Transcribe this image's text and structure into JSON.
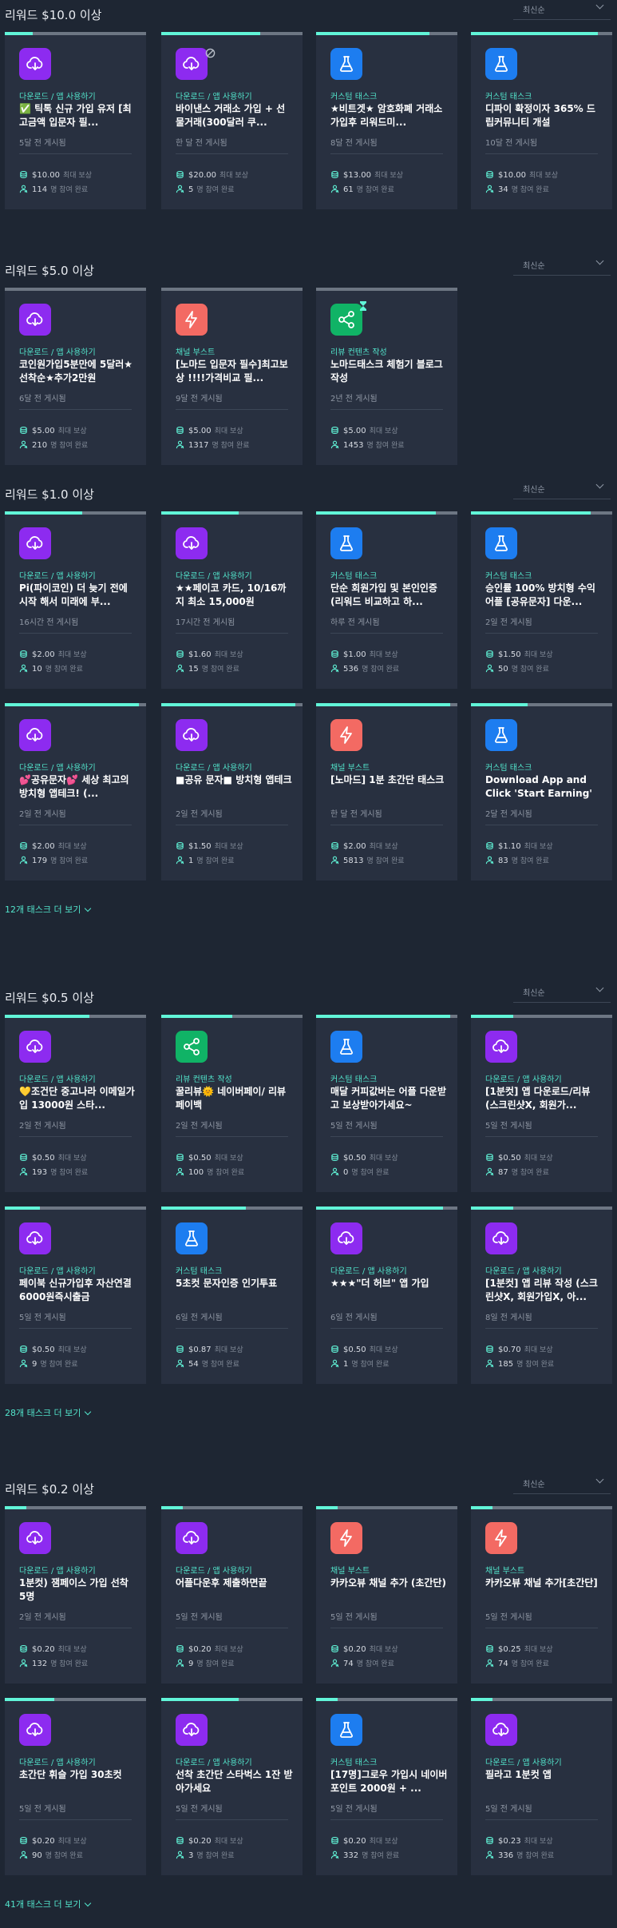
{
  "sort_label": "최신순",
  "labels": {
    "max_reward": "최대 보상",
    "participants": "명 참여 완료"
  },
  "sections": [
    {
      "title": "리워드 $10.0 이상",
      "tasks": [
        {
          "icon": "download-cloud-icon",
          "color": "purple",
          "progress": 0.2,
          "category": "다운로드 / 앱 사용하기",
          "title": "✅ 틱톡 신규 가입 유저 [최고금액 입문자 필...",
          "posted": "5달 전 게시됨",
          "reward": "$10.00",
          "people": "114"
        },
        {
          "icon": "download-cloud-icon",
          "color": "purple",
          "progress": 0.7,
          "blocked": true,
          "category": "다운로드 / 앱 사용하기",
          "title": "바이낸스 거래소 가입 + 선물거래(300달러 쿠...",
          "posted": "한 달 전 게시됨",
          "reward": "$20.00",
          "people": "5"
        },
        {
          "icon": "flask-icon",
          "color": "blue",
          "progress": 0.8,
          "category": "커스텀 태스크",
          "title": "★비트겟★ 암호화폐 거래소 가입후 리워드미...",
          "posted": "8달 전 게시됨",
          "reward": "$13.00",
          "people": "61"
        },
        {
          "icon": "flask-icon",
          "color": "blue",
          "progress": 0.9,
          "category": "커스텀 태스크",
          "title": "디파이 확정이자 365% 드립커뮤니티 개설",
          "posted": "10달 전 게시됨",
          "reward": "$10.00",
          "people": "34"
        }
      ]
    },
    {
      "title": "리워드 $5.0 이상",
      "tasks": [
        {
          "icon": "download-cloud-icon",
          "color": "purple",
          "progress": 0.0,
          "category": "다운로드 / 앱 사용하기",
          "title": "코인원가입5분만에 5달러★선착순★추가2만원",
          "posted": "6달 전 게시됨",
          "reward": "$5.00",
          "people": "210"
        },
        {
          "icon": "lightning-icon",
          "color": "red",
          "progress": 0.0,
          "category": "채널 부스트",
          "title": "[노마드 입문자 필수]최고보상 !!!!가격비교 필...",
          "posted": "9달 전 게시됨",
          "reward": "$5.00",
          "people": "1317"
        },
        {
          "icon": "share-icon",
          "color": "green",
          "progress": 0.0,
          "pinned": true,
          "category": "리뷰 컨텐츠 작성",
          "title": "노마드태스크 체험기 블로그 작성",
          "posted": "2년 전 게시됨",
          "reward": "$5.00",
          "people": "1453"
        }
      ]
    },
    {
      "title": "리워드 $1.0 이상",
      "tasks": [
        {
          "icon": "download-cloud-icon",
          "color": "purple",
          "progress": 0.55,
          "category": "다운로드 / 앱 사용하기",
          "title": "Pi(파이코인) 더 늦기 전에 시작 해서 미래에 부...",
          "posted": "16시간 전 게시됨",
          "reward": "$2.00",
          "people": "10"
        },
        {
          "icon": "download-cloud-icon",
          "color": "purple",
          "progress": 0.55,
          "category": "다운로드 / 앱 사용하기",
          "title": "★★페이코 카드, 10/16까지 최소 15,000원",
          "posted": "17시간 전 게시됨",
          "reward": "$1.60",
          "people": "15"
        },
        {
          "icon": "flask-icon",
          "color": "blue",
          "progress": 0.85,
          "category": "커스텀 태스크",
          "title": "단순 회원가입 및 본인인증(리워드 비교하고 하...",
          "posted": "하루 전 게시됨",
          "reward": "$1.00",
          "people": "536"
        },
        {
          "icon": "flask-icon",
          "color": "blue",
          "progress": 0.85,
          "category": "커스텀 태스크",
          "title": "승인률 100% 방치형 수익어플 [공유문자] 다운...",
          "posted": "2일 전 게시됨",
          "reward": "$1.50",
          "people": "50"
        },
        {
          "icon": "download-cloud-icon",
          "color": "purple",
          "progress": 0.95,
          "category": "다운로드 / 앱 사용하기",
          "title": "💕공유문자💕 세상 최고의 방치형 앱테크! (...",
          "posted": "2일 전 게시됨",
          "reward": "$2.00",
          "people": "179"
        },
        {
          "icon": "download-cloud-icon",
          "color": "purple",
          "progress": 0.95,
          "category": "다운로드 / 앱 사용하기",
          "title": "■공유 문자■ 방치형 앱테크",
          "posted": "2일 전 게시됨",
          "reward": "$1.50",
          "people": "1"
        },
        {
          "icon": "lightning-icon",
          "color": "red",
          "progress": 0.95,
          "category": "채널 부스트",
          "title": "[노마드] 1분 초간단 태스크",
          "posted": "한 달 전 게시됨",
          "reward": "$2.00",
          "people": "5813"
        },
        {
          "icon": "flask-icon",
          "color": "blue",
          "progress": 0.4,
          "category": "커스텀 태스크",
          "title": "Download App and Click 'Start Earning' Daily 💸 ...",
          "posted": "2달 전 게시됨",
          "reward": "$1.10",
          "people": "83"
        }
      ],
      "more": "12개 태스크 더 보기"
    },
    {
      "title": "리워드 $0.5 이상",
      "tasks": [
        {
          "icon": "download-cloud-icon",
          "color": "purple",
          "progress": 0.6,
          "category": "다운로드 / 앱 사용하기",
          "title": "💛조건단 중고나라 이메일가입 13000원 스타...",
          "posted": "2일 전 게시됨",
          "reward": "$0.50",
          "people": "193"
        },
        {
          "icon": "share-icon",
          "color": "green",
          "progress": 0.5,
          "category": "리뷰 컨텐츠 작성",
          "title": "꿀리뷰🌞 네이버페이/ 리뷰 페이백",
          "posted": "2일 전 게시됨",
          "reward": "$0.50",
          "people": "100"
        },
        {
          "icon": "flask-icon",
          "color": "blue",
          "progress": 0.95,
          "category": "커스텀 태스크",
          "title": "매달 커피값버는 어플 다운받고 보상받아가세요~",
          "posted": "5일 전 게시됨",
          "reward": "$0.50",
          "people": "0"
        },
        {
          "icon": "download-cloud-icon",
          "color": "purple",
          "progress": 0.3,
          "category": "다운로드 / 앱 사용하기",
          "title": "[1분컷] 앱 다운로드/리뷰 (스크린샷X, 회원가...",
          "posted": "5일 전 게시됨",
          "reward": "$0.50",
          "people": "87"
        },
        {
          "icon": "download-cloud-icon",
          "color": "purple",
          "progress": 0.25,
          "category": "다운로드 / 앱 사용하기",
          "title": "페이북 신규가입후 자산연결 6000원즉시출금",
          "posted": "5일 전 게시됨",
          "reward": "$0.50",
          "people": "9"
        },
        {
          "icon": "flask-icon",
          "color": "blue",
          "progress": 0.6,
          "category": "커스텀 태스크",
          "title": "5초컷 문자인증 인기투표",
          "posted": "6일 전 게시됨",
          "reward": "$0.87",
          "people": "54"
        },
        {
          "icon": "download-cloud-icon",
          "color": "purple",
          "progress": 0.9,
          "category": "다운로드 / 앱 사용하기",
          "title": "★★★\"더 허브\" 앱 가입",
          "posted": "6일 전 게시됨",
          "reward": "$0.50",
          "people": "1"
        },
        {
          "icon": "download-cloud-icon",
          "color": "purple",
          "progress": 0.3,
          "category": "다운로드 / 앱 사용하기",
          "title": "[1분컷] 앱 리뷰 작성 (스크린샷X, 회원가입X, 아...",
          "posted": "8일 전 게시됨",
          "reward": "$0.70",
          "people": "185"
        }
      ],
      "more": "28개 태스크 더 보기"
    },
    {
      "title": "리워드 $0.2 이상",
      "tasks": [
        {
          "icon": "download-cloud-icon",
          "color": "purple",
          "progress": 0.15,
          "category": "다운로드 / 앱 사용하기",
          "title": "1분컷) 잼페이스 가입 선착 5명",
          "posted": "2일 전 게시됨",
          "reward": "$0.20",
          "people": "132"
        },
        {
          "icon": "download-cloud-icon",
          "color": "purple",
          "progress": 0.15,
          "category": "다운로드 / 앱 사용하기",
          "title": "어플다운후 제출하면끝",
          "posted": "5일 전 게시됨",
          "reward": "$0.20",
          "people": "9"
        },
        {
          "icon": "lightning-icon",
          "color": "red",
          "progress": 0.15,
          "category": "채널 부스트",
          "title": "카카오뷰 채널 추가 (초간단)",
          "posted": "5일 전 게시됨",
          "reward": "$0.20",
          "people": "74"
        },
        {
          "icon": "lightning-icon",
          "color": "red",
          "progress": 0.15,
          "category": "채널 부스트",
          "title": "카카오뷰 채널 추가[초간단]",
          "posted": "5일 전 게시됨",
          "reward": "$0.25",
          "people": "74"
        },
        {
          "icon": "download-cloud-icon",
          "color": "purple",
          "progress": 0.35,
          "category": "다운로드 / 앱 사용하기",
          "title": "초간단 휘슬 가입 30초컷",
          "posted": "5일 전 게시됨",
          "reward": "$0.20",
          "people": "90"
        },
        {
          "icon": "download-cloud-icon",
          "color": "purple",
          "progress": 0.55,
          "category": "다운로드 / 앱 사용하기",
          "title": "선착 초간단 스타벅스 1잔 받아가세요",
          "posted": "5일 전 게시됨",
          "reward": "$0.20",
          "people": "3"
        },
        {
          "icon": "flask-icon",
          "color": "blue",
          "progress": 0.15,
          "category": "커스텀 태스크",
          "title": "[17명]그로우 가입시 네이버포인트 2000원 + ...",
          "posted": "5일 전 게시됨",
          "reward": "$0.20",
          "people": "332"
        },
        {
          "icon": "download-cloud-icon",
          "color": "purple",
          "progress": 0.15,
          "category": "다운로드 / 앱 사용하기",
          "title": "필라고 1분컷 앱",
          "posted": "5일 전 게시됨",
          "reward": "$0.23",
          "people": "336"
        }
      ],
      "more": "41개 태스크 더 보기"
    }
  ]
}
